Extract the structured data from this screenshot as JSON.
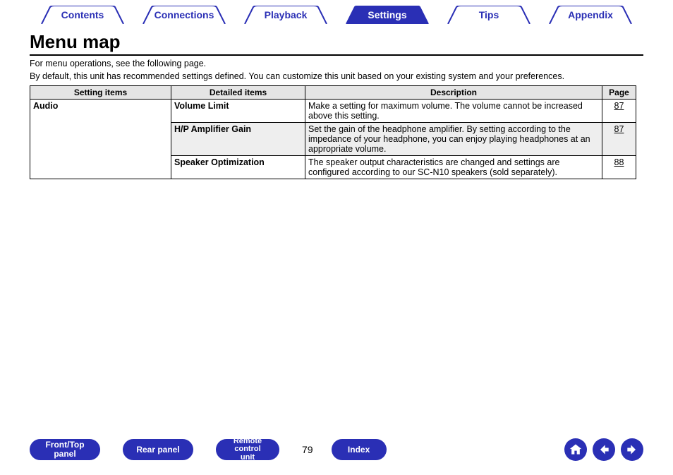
{
  "tabs": {
    "contents": {
      "label": "Contents",
      "active": false
    },
    "connections": {
      "label": "Connections",
      "active": false
    },
    "playback": {
      "label": "Playback",
      "active": false
    },
    "settings": {
      "label": "Settings",
      "active": true
    },
    "tips": {
      "label": "Tips",
      "active": false
    },
    "appendix": {
      "label": "Appendix",
      "active": false
    }
  },
  "title": "Menu map",
  "intro": {
    "line1": "For menu operations, see the following page.",
    "line2": "By default, this unit has recommended settings defined. You can customize this unit based on your existing system and your preferences."
  },
  "table": {
    "headers": {
      "setting": "Setting items",
      "detail": "Detailed items",
      "desc": "Description",
      "page": "Page"
    },
    "setting_group": "Audio",
    "rows": [
      {
        "detail": "Volume Limit",
        "desc": "Make a setting for maximum volume. The volume cannot be increased above this setting.",
        "page": "87",
        "shaded": false
      },
      {
        "detail": "H/P Amplifier Gain",
        "desc": "Set the gain of the headphone amplifier. By setting according to the impedance of your headphone, you can enjoy playing headphones at an appropriate volume.",
        "page": "87",
        "shaded": true
      },
      {
        "detail": "Speaker Optimization",
        "desc": "The speaker output characteristics are changed and settings are configured according to our SC-N10 speakers (sold separately).",
        "page": "88",
        "shaded": false
      }
    ]
  },
  "footer": {
    "front_top": "Front/Top\npanel",
    "rear_panel": "Rear panel",
    "remote": "Remote control\nunit",
    "index": "Index",
    "page_number": "79"
  }
}
